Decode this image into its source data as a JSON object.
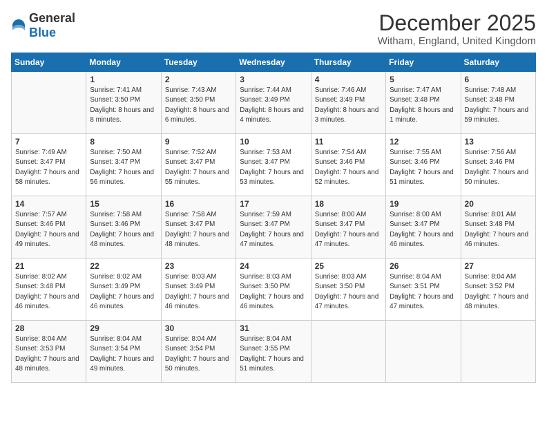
{
  "header": {
    "logo": {
      "general": "General",
      "blue": "Blue"
    },
    "month": "December 2025",
    "location": "Witham, England, United Kingdom"
  },
  "weekdays": [
    "Sunday",
    "Monday",
    "Tuesday",
    "Wednesday",
    "Thursday",
    "Friday",
    "Saturday"
  ],
  "weeks": [
    [
      {
        "day": null
      },
      {
        "day": 1,
        "sunrise": "7:41 AM",
        "sunset": "3:50 PM",
        "daylight": "8 hours and 8 minutes."
      },
      {
        "day": 2,
        "sunrise": "7:43 AM",
        "sunset": "3:50 PM",
        "daylight": "8 hours and 6 minutes."
      },
      {
        "day": 3,
        "sunrise": "7:44 AM",
        "sunset": "3:49 PM",
        "daylight": "8 hours and 4 minutes."
      },
      {
        "day": 4,
        "sunrise": "7:46 AM",
        "sunset": "3:49 PM",
        "daylight": "8 hours and 3 minutes."
      },
      {
        "day": 5,
        "sunrise": "7:47 AM",
        "sunset": "3:48 PM",
        "daylight": "8 hours and 1 minute."
      },
      {
        "day": 6,
        "sunrise": "7:48 AM",
        "sunset": "3:48 PM",
        "daylight": "7 hours and 59 minutes."
      }
    ],
    [
      {
        "day": 7,
        "sunrise": "7:49 AM",
        "sunset": "3:47 PM",
        "daylight": "7 hours and 58 minutes."
      },
      {
        "day": 8,
        "sunrise": "7:50 AM",
        "sunset": "3:47 PM",
        "daylight": "7 hours and 56 minutes."
      },
      {
        "day": 9,
        "sunrise": "7:52 AM",
        "sunset": "3:47 PM",
        "daylight": "7 hours and 55 minutes."
      },
      {
        "day": 10,
        "sunrise": "7:53 AM",
        "sunset": "3:47 PM",
        "daylight": "7 hours and 53 minutes."
      },
      {
        "day": 11,
        "sunrise": "7:54 AM",
        "sunset": "3:46 PM",
        "daylight": "7 hours and 52 minutes."
      },
      {
        "day": 12,
        "sunrise": "7:55 AM",
        "sunset": "3:46 PM",
        "daylight": "7 hours and 51 minutes."
      },
      {
        "day": 13,
        "sunrise": "7:56 AM",
        "sunset": "3:46 PM",
        "daylight": "7 hours and 50 minutes."
      }
    ],
    [
      {
        "day": 14,
        "sunrise": "7:57 AM",
        "sunset": "3:46 PM",
        "daylight": "7 hours and 49 minutes."
      },
      {
        "day": 15,
        "sunrise": "7:58 AM",
        "sunset": "3:46 PM",
        "daylight": "7 hours and 48 minutes."
      },
      {
        "day": 16,
        "sunrise": "7:58 AM",
        "sunset": "3:47 PM",
        "daylight": "7 hours and 48 minutes."
      },
      {
        "day": 17,
        "sunrise": "7:59 AM",
        "sunset": "3:47 PM",
        "daylight": "7 hours and 47 minutes."
      },
      {
        "day": 18,
        "sunrise": "8:00 AM",
        "sunset": "3:47 PM",
        "daylight": "7 hours and 47 minutes."
      },
      {
        "day": 19,
        "sunrise": "8:00 AM",
        "sunset": "3:47 PM",
        "daylight": "7 hours and 46 minutes."
      },
      {
        "day": 20,
        "sunrise": "8:01 AM",
        "sunset": "3:48 PM",
        "daylight": "7 hours and 46 minutes."
      }
    ],
    [
      {
        "day": 21,
        "sunrise": "8:02 AM",
        "sunset": "3:48 PM",
        "daylight": "7 hours and 46 minutes."
      },
      {
        "day": 22,
        "sunrise": "8:02 AM",
        "sunset": "3:49 PM",
        "daylight": "7 hours and 46 minutes."
      },
      {
        "day": 23,
        "sunrise": "8:03 AM",
        "sunset": "3:49 PM",
        "daylight": "7 hours and 46 minutes."
      },
      {
        "day": 24,
        "sunrise": "8:03 AM",
        "sunset": "3:50 PM",
        "daylight": "7 hours and 46 minutes."
      },
      {
        "day": 25,
        "sunrise": "8:03 AM",
        "sunset": "3:50 PM",
        "daylight": "7 hours and 47 minutes."
      },
      {
        "day": 26,
        "sunrise": "8:04 AM",
        "sunset": "3:51 PM",
        "daylight": "7 hours and 47 minutes."
      },
      {
        "day": 27,
        "sunrise": "8:04 AM",
        "sunset": "3:52 PM",
        "daylight": "7 hours and 48 minutes."
      }
    ],
    [
      {
        "day": 28,
        "sunrise": "8:04 AM",
        "sunset": "3:53 PM",
        "daylight": "7 hours and 48 minutes."
      },
      {
        "day": 29,
        "sunrise": "8:04 AM",
        "sunset": "3:54 PM",
        "daylight": "7 hours and 49 minutes."
      },
      {
        "day": 30,
        "sunrise": "8:04 AM",
        "sunset": "3:54 PM",
        "daylight": "7 hours and 50 minutes."
      },
      {
        "day": 31,
        "sunrise": "8:04 AM",
        "sunset": "3:55 PM",
        "daylight": "7 hours and 51 minutes."
      },
      {
        "day": null
      },
      {
        "day": null
      },
      {
        "day": null
      }
    ]
  ],
  "labels": {
    "sunrise_prefix": "Sunrise: ",
    "sunset_prefix": "Sunset: ",
    "daylight_prefix": "Daylight: "
  }
}
